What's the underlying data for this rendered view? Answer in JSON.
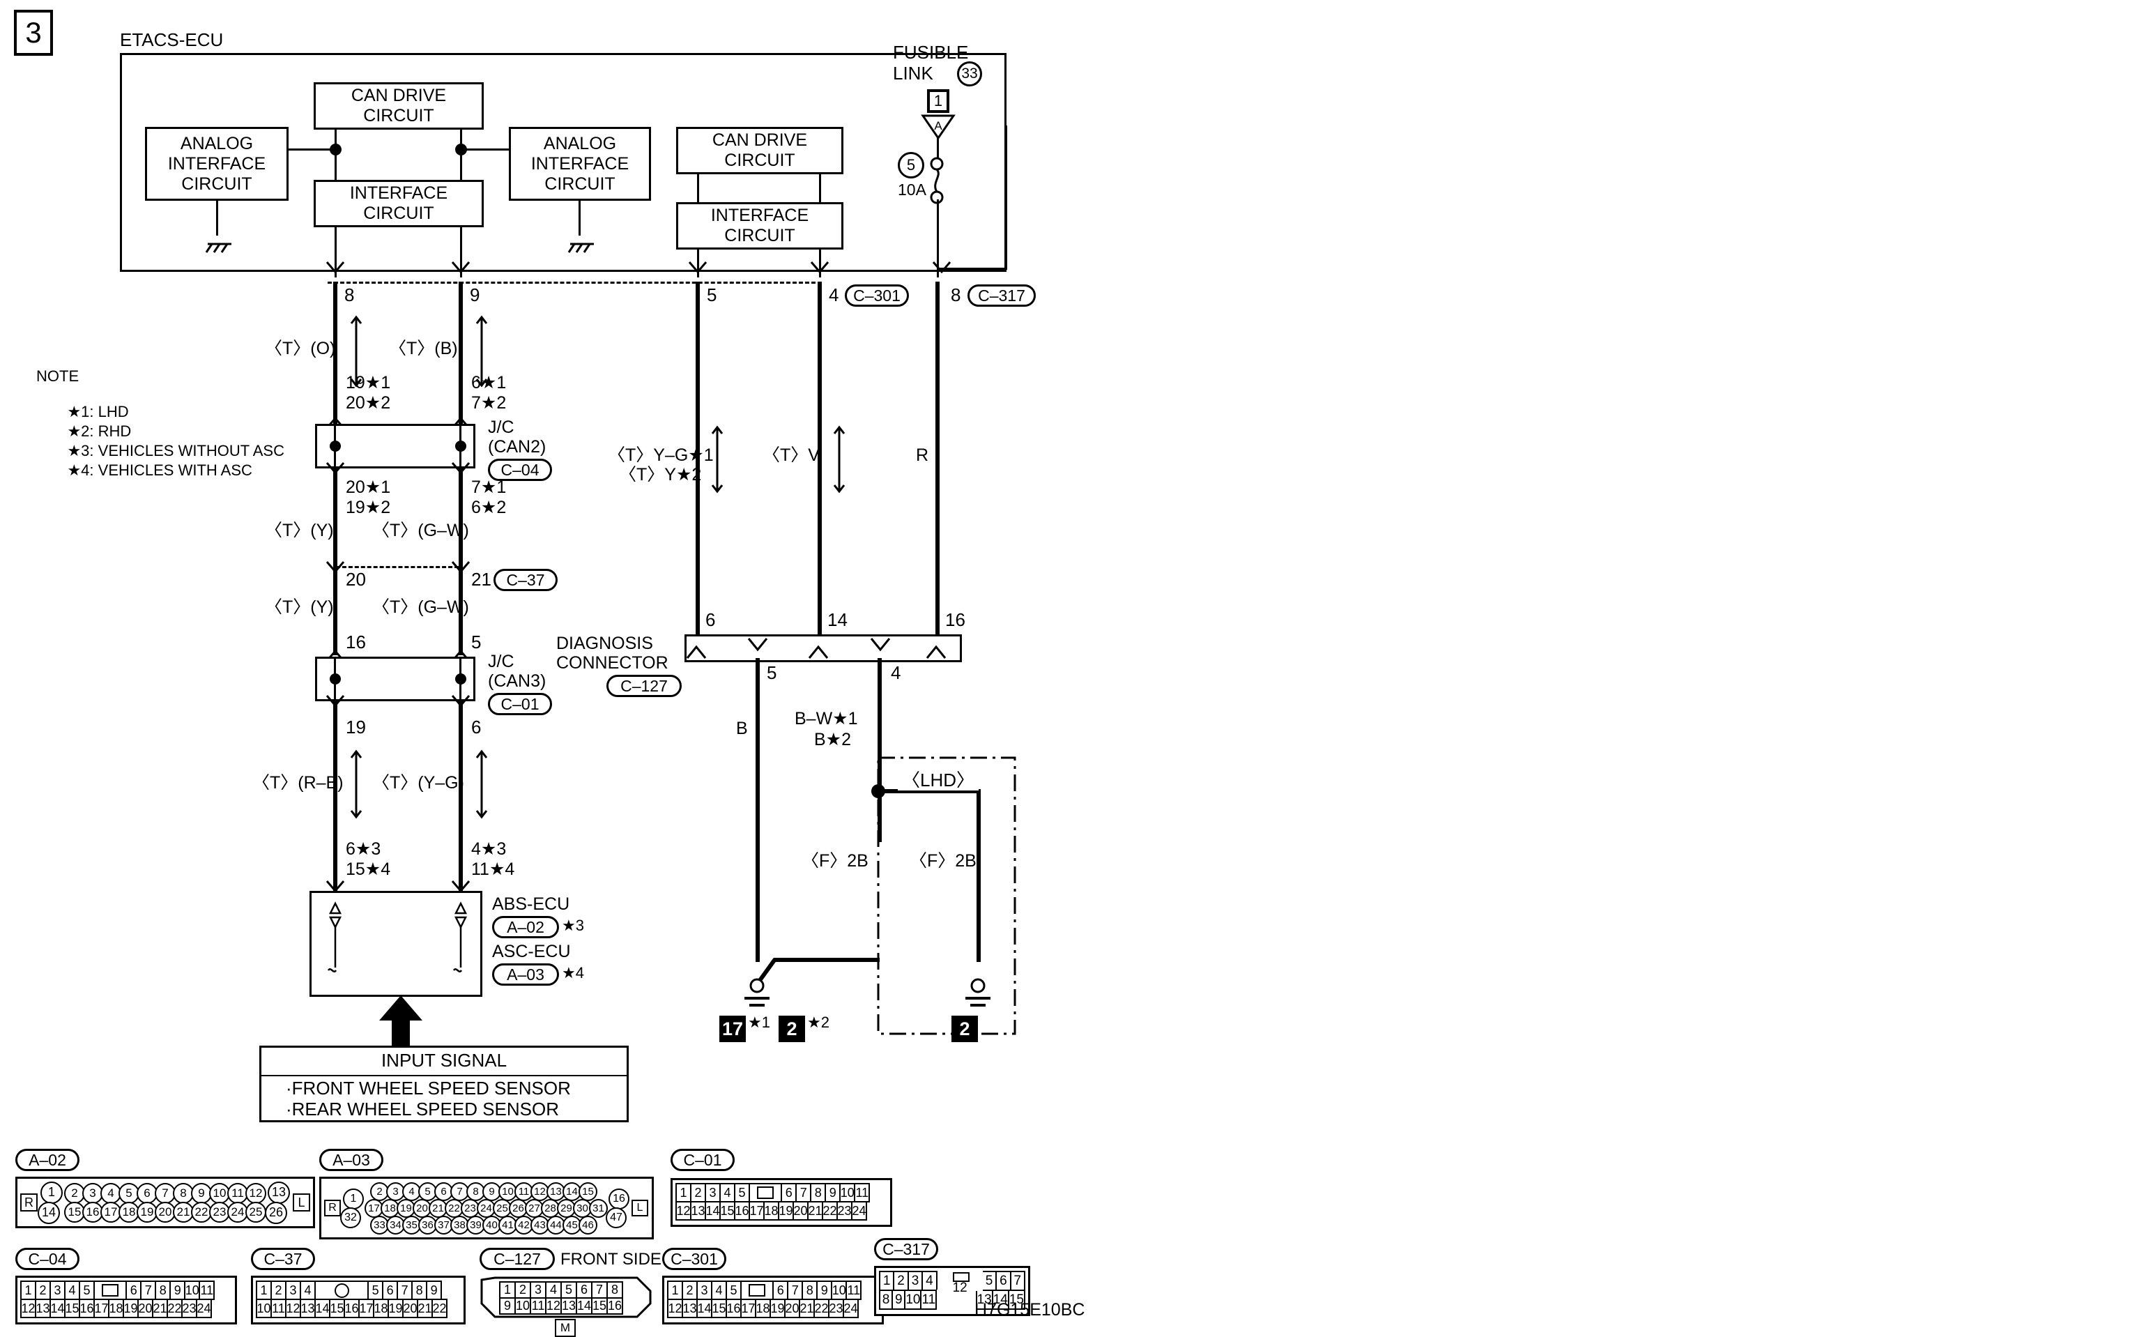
{
  "page": {
    "step_number": "3",
    "drawing_code": "H7G15E10BC"
  },
  "ecu": {
    "title": "ETACS-ECU",
    "blocks": [
      {
        "id": "can-drive-1",
        "line1": "CAN DRIVE",
        "line2": "CIRCUIT"
      },
      {
        "id": "analog-interface-1",
        "line1": "ANALOG",
        "line2": "INTERFACE",
        "line3": "CIRCUIT"
      },
      {
        "id": "interface-1",
        "line1": "INTERFACE",
        "line2": "CIRCUIT"
      },
      {
        "id": "analog-interface-2",
        "line1": "ANALOG",
        "line2": "INTERFACE",
        "line3": "CIRCUIT"
      },
      {
        "id": "can-drive-2",
        "line1": "CAN DRIVE",
        "line2": "CIRCUIT"
      },
      {
        "id": "interface-2",
        "line1": "INTERFACE",
        "line2": "CIRCUIT"
      }
    ]
  },
  "fusible_link": {
    "label_line1": "FUSIBLE",
    "label_line2": "LINK",
    "circle_ref": "33",
    "box_ref": "1",
    "triangle_ref": "A",
    "fuse_circle": "5",
    "fuse_rating": "10A"
  },
  "note": {
    "title": "NOTE",
    "items": [
      {
        "mark": "★1",
        "text": ": LHD"
      },
      {
        "mark": "★2",
        "text": ": RHD"
      },
      {
        "mark": "★3",
        "text": ": VEHICLES WITHOUT ASC"
      },
      {
        "mark": "★4",
        "text": ": VEHICLES WITH ASC"
      }
    ]
  },
  "ecu_pins": {
    "pin8": "8",
    "pin9": "9",
    "pin5": "5",
    "pin4": "4",
    "conn_c301": "C–301",
    "pin8b": "8",
    "conn_c317": "C–317"
  },
  "wires": {
    "t_o": "〈T〉(O)",
    "t_b": "〈T〉(B)",
    "t_y": "〈T〉(Y)",
    "t_gw": "〈T〉(G–W)",
    "t_rb": "〈T〉(R–B)",
    "t_yg": "〈T〉(Y–G)",
    "t_yg_star1": "〈T〉Y–G★1",
    "t_y_star2": "〈T〉Y★2",
    "t_v": "〈T〉V",
    "r": "R",
    "b": "B",
    "bw_star1": "B–W★1",
    "b_star2": "B★2",
    "f2b_left": "〈F〉2B",
    "f2b_right": "〈F〉2B"
  },
  "jc_can2": {
    "label1": "J/C",
    "label2": "(CAN2)",
    "connector": "C–04",
    "top_left_1": "19★1",
    "top_left_2": "20★2",
    "top_right_1": "6★1",
    "top_right_2": "7★2",
    "bot_left_1": "20★1",
    "bot_left_2": "19★2",
    "bot_right_1": "7★1",
    "bot_right_2": "6★2"
  },
  "c37": {
    "pin_left": "20",
    "pin_right": "21",
    "connector": "C–37"
  },
  "jc_can3": {
    "label1": "J/C",
    "label2": "(CAN3)",
    "connector": "C–01",
    "top_left": "16",
    "top_right": "5",
    "bot_left": "19",
    "bot_right": "6"
  },
  "abs_ecu": {
    "pin_left_1": "6★3",
    "pin_left_2": "15★4",
    "pin_right_1": "4★3",
    "pin_right_2": "11★4",
    "name1": "ABS-ECU",
    "conn1": "A–02",
    "star1": "★3",
    "name2": "ASC-ECU",
    "conn2": "A–03",
    "star2": "★4"
  },
  "input_signal": {
    "title": "INPUT SIGNAL",
    "items": [
      "·FRONT WHEEL SPEED SENSOR",
      "·REAR WHEEL SPEED SENSOR"
    ]
  },
  "diagnosis_connector": {
    "label1": "DIAGNOSIS",
    "label2": "CONNECTOR",
    "connector": "C–127",
    "pin6": "6",
    "pin14": "14",
    "pin16": "16",
    "pin5": "5",
    "pin4": "4"
  },
  "lhd_region": {
    "label": "〈LHD〉"
  },
  "grounds": [
    {
      "id": "ground-17",
      "badge": "17",
      "star": "★1"
    },
    {
      "id": "ground-2-rhd",
      "badge": "2",
      "star": "★2"
    },
    {
      "id": "ground-2-lhd",
      "badge": "2",
      "star": ""
    }
  ],
  "connectors": [
    {
      "id": "A-02",
      "name": "A–02",
      "type": "round-left-right",
      "left_mark": "R",
      "right_mark": "L",
      "left_col": [
        "1",
        "14"
      ],
      "right_col": [
        "13",
        "26"
      ],
      "rows": [
        [
          "2",
          "3",
          "4",
          "5",
          "6",
          "7",
          "8",
          "9",
          "10",
          "11",
          "12"
        ],
        [
          "15",
          "16",
          "17",
          "18",
          "19",
          "20",
          "21",
          "22",
          "23",
          "24",
          "25"
        ]
      ]
    },
    {
      "id": "A-03",
      "name": "A–03",
      "type": "round-left-right-3row",
      "left_mark": "R",
      "right_mark": "L",
      "left_col": [
        "1",
        "32"
      ],
      "right_col": [
        "16",
        "47"
      ],
      "rows": [
        [
          "2",
          "3",
          "4",
          "5",
          "6",
          "7",
          "8",
          "9",
          "10",
          "11",
          "12",
          "13",
          "14",
          "15"
        ],
        [
          "17",
          "18",
          "19",
          "20",
          "21",
          "22",
          "23",
          "24",
          "25",
          "26",
          "27",
          "28",
          "29",
          "30",
          "31"
        ],
        [
          "33",
          "34",
          "35",
          "36",
          "37",
          "38",
          "39",
          "40",
          "41",
          "42",
          "43",
          "44",
          "45",
          "46"
        ]
      ]
    },
    {
      "id": "C-01",
      "name": "C–01",
      "type": "square-notch",
      "rows": [
        [
          "1",
          "2",
          "3",
          "4",
          "5",
          "notch",
          "6",
          "7",
          "8",
          "9",
          "10",
          "11"
        ],
        [
          "12",
          "13",
          "14",
          "15",
          "16",
          "17",
          "18",
          "19",
          "20",
          "21",
          "22",
          "23",
          "24"
        ]
      ]
    },
    {
      "id": "C-04",
      "name": "C–04",
      "type": "square-notch",
      "rows": [
        [
          "1",
          "2",
          "3",
          "4",
          "5",
          "notch",
          "6",
          "7",
          "8",
          "9",
          "10",
          "11"
        ],
        [
          "12",
          "13",
          "14",
          "15",
          "16",
          "17",
          "18",
          "19",
          "20",
          "21",
          "22",
          "23",
          "24"
        ]
      ]
    },
    {
      "id": "C-37",
      "name": "C–37",
      "type": "square-circle",
      "rows": [
        [
          "1",
          "2",
          "3",
          "4",
          "circle",
          "5",
          "6",
          "7",
          "8",
          "9"
        ],
        [
          "10",
          "11",
          "12",
          "13",
          "14",
          "15",
          "16",
          "17",
          "18",
          "19",
          "20",
          "21",
          "22"
        ]
      ]
    },
    {
      "id": "C-127",
      "name": "C–127",
      "side_label": "FRONT SIDE",
      "type": "dsub",
      "tab": "M",
      "rows": [
        [
          "1",
          "2",
          "3",
          "4",
          "5",
          "6",
          "7",
          "8"
        ],
        [
          "9",
          "10",
          "11",
          "12",
          "13",
          "14",
          "15",
          "16"
        ]
      ]
    },
    {
      "id": "C-301",
      "name": "C–301",
      "type": "square-notch",
      "rows": [
        [
          "1",
          "2",
          "3",
          "4",
          "5",
          "notch",
          "6",
          "7",
          "8",
          "9",
          "10",
          "11"
        ],
        [
          "12",
          "13",
          "14",
          "15",
          "16",
          "17",
          "18",
          "19",
          "20",
          "21",
          "22",
          "23",
          "24"
        ]
      ]
    },
    {
      "id": "C-317",
      "name": "C–317",
      "type": "square-split",
      "rows": [
        [
          "1",
          "2",
          "3",
          "4",
          "gap12",
          "5",
          "6",
          "7"
        ],
        [
          "8",
          "9",
          "10",
          "11",
          "gap12",
          "13",
          "14",
          "15"
        ]
      ],
      "center_pin": "12"
    }
  ]
}
